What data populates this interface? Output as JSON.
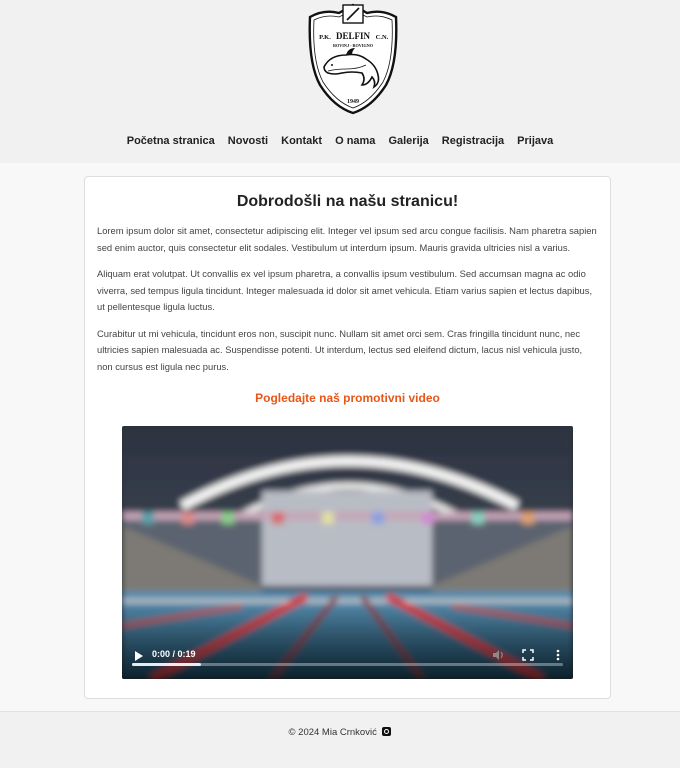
{
  "club": {
    "name": "P.K. DELFIN C.N.",
    "name_left": "P.K.",
    "name_main": "DELFIN",
    "name_right": "C.N.",
    "city": "ROVINJ - ROVIGNO",
    "year": "1949"
  },
  "nav": {
    "items": [
      "Početna stranica",
      "Novosti",
      "Kontakt",
      "O nama",
      "Galerija",
      "Registracija",
      "Prijava"
    ]
  },
  "main": {
    "title": "Dobrodošli na našu stranicu!",
    "paragraphs": [
      "Lorem ipsum dolor sit amet, consectetur adipiscing elit. Integer vel ipsum sed arcu congue facilisis. Nam pharetra sapien sed enim auctor, quis consectetur elit sodales. Vestibulum ut interdum ipsum. Mauris gravida ultricies nisl a varius.",
      "Aliquam erat volutpat. Ut convallis ex vel ipsum pharetra, a convallis ipsum vestibulum. Sed accumsan magna ac odio viverra, sed tempus ligula tincidunt. Integer malesuada id dolor sit amet vehicula. Etiam varius sapien et lectus dapibus, ut pellentesque ligula luctus.",
      "Curabitur ut mi vehicula, tincidunt eros non, suscipit nunc. Nullam sit amet orci sem. Cras fringilla tincidunt nunc, nec ultricies sapien malesuada ac. Suspendisse potenti. Ut interdum, lectus sed eleifend dictum, lacus nisl vehicula justo, non cursus est ligula nec purus."
    ],
    "promo_heading": "Pogledajte naš promotivni video"
  },
  "video": {
    "time": "0:00 / 0:19",
    "progress": 0.16,
    "icons": [
      "play-icon",
      "volume-icon",
      "fullscreen-icon",
      "more-options-icon"
    ]
  },
  "footer": {
    "copyright": "© 2024 Mia Crnković",
    "social_icon": "instagram-icon"
  },
  "colors": {
    "accent": "#e8571a",
    "header_bg": "#f1f1f1",
    "page_bg": "#f8f8f8"
  }
}
